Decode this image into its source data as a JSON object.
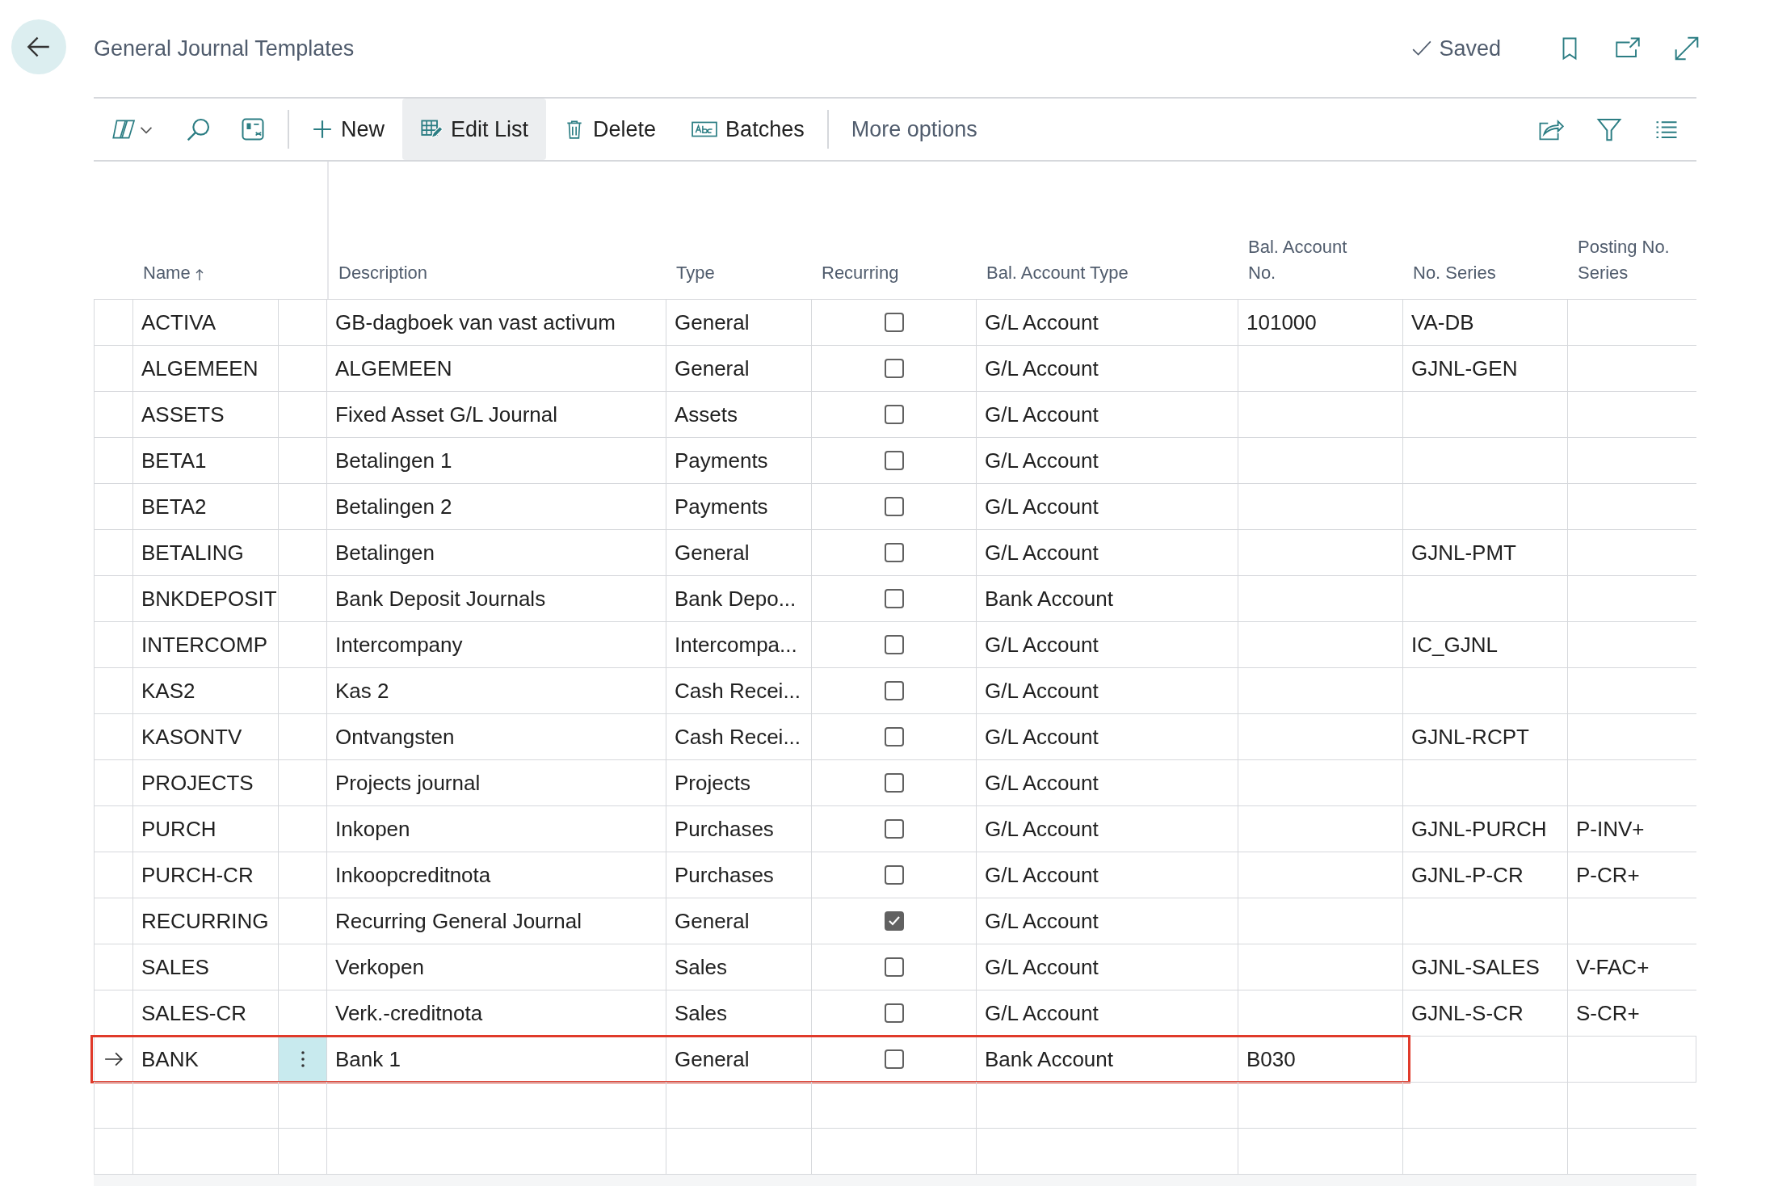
{
  "page": {
    "title": "General Journal Templates",
    "status": "Saved"
  },
  "toolbar": {
    "actions": [
      {
        "label": "New",
        "kind": "new",
        "selected": false
      },
      {
        "label": "Edit List",
        "kind": "edit",
        "selected": true
      },
      {
        "label": "Delete",
        "kind": "delete",
        "selected": false
      },
      {
        "label": "Batches",
        "kind": "batches",
        "selected": false
      }
    ],
    "more": "More options"
  },
  "table": {
    "columns": [
      {
        "label": "Name",
        "sorted": true
      },
      {
        "label": "Description",
        "sorted": false
      },
      {
        "label": "Type",
        "sorted": false
      },
      {
        "label": "Recurring",
        "sorted": false
      },
      {
        "label": "Bal. Account Type",
        "sorted": false
      },
      {
        "label": "Bal. Account No.",
        "sorted": false
      },
      {
        "label": "No. Series",
        "sorted": false
      },
      {
        "label": "Posting No. Series",
        "sorted": false
      }
    ],
    "rows": [
      {
        "name": "ACTIVA",
        "description": "GB-dagboek van vast activum",
        "type": "General",
        "recurring": false,
        "bal_account_type": "G/L Account",
        "bal_account_no": "101000",
        "no_series": "VA-DB",
        "posting_no_series": "",
        "selected": false
      },
      {
        "name": "ALGEMEEN",
        "description": "ALGEMEEN",
        "type": "General",
        "recurring": false,
        "bal_account_type": "G/L Account",
        "bal_account_no": "",
        "no_series": "GJNL-GEN",
        "posting_no_series": "",
        "selected": false
      },
      {
        "name": "ASSETS",
        "description": "Fixed Asset G/L Journal",
        "type": "Assets",
        "recurring": false,
        "bal_account_type": "G/L Account",
        "bal_account_no": "",
        "no_series": "",
        "posting_no_series": "",
        "selected": false
      },
      {
        "name": "BETA1",
        "description": "Betalingen 1",
        "type": "Payments",
        "recurring": false,
        "bal_account_type": "G/L Account",
        "bal_account_no": "",
        "no_series": "",
        "posting_no_series": "",
        "selected": false
      },
      {
        "name": "BETA2",
        "description": "Betalingen 2",
        "type": "Payments",
        "recurring": false,
        "bal_account_type": "G/L Account",
        "bal_account_no": "",
        "no_series": "",
        "posting_no_series": "",
        "selected": false
      },
      {
        "name": "BETALING",
        "description": "Betalingen",
        "type": "General",
        "recurring": false,
        "bal_account_type": "G/L Account",
        "bal_account_no": "",
        "no_series": "GJNL-PMT",
        "posting_no_series": "",
        "selected": false
      },
      {
        "name": "BNKDEPOSIT",
        "description": "Bank Deposit Journals",
        "type": "Bank Depo...",
        "recurring": false,
        "bal_account_type": "Bank Account",
        "bal_account_no": "",
        "no_series": "",
        "posting_no_series": "",
        "selected": false
      },
      {
        "name": "INTERCOMP",
        "description": "Intercompany",
        "type": "Intercompa...",
        "recurring": false,
        "bal_account_type": "G/L Account",
        "bal_account_no": "",
        "no_series": "IC_GJNL",
        "posting_no_series": "",
        "selected": false
      },
      {
        "name": "KAS2",
        "description": "Kas 2",
        "type": "Cash Recei...",
        "recurring": false,
        "bal_account_type": "G/L Account",
        "bal_account_no": "",
        "no_series": "",
        "posting_no_series": "",
        "selected": false
      },
      {
        "name": "KASONTV",
        "description": "Ontvangsten",
        "type": "Cash Recei...",
        "recurring": false,
        "bal_account_type": "G/L Account",
        "bal_account_no": "",
        "no_series": "GJNL-RCPT",
        "posting_no_series": "",
        "selected": false
      },
      {
        "name": "PROJECTS",
        "description": "Projects journal",
        "type": "Projects",
        "recurring": false,
        "bal_account_type": "G/L Account",
        "bal_account_no": "",
        "no_series": "",
        "posting_no_series": "",
        "selected": false
      },
      {
        "name": "PURCH",
        "description": "Inkopen",
        "type": "Purchases",
        "recurring": false,
        "bal_account_type": "G/L Account",
        "bal_account_no": "",
        "no_series": "GJNL-PURCH",
        "posting_no_series": "P-INV+",
        "selected": false
      },
      {
        "name": "PURCH-CR",
        "description": "Inkoopcreditnota",
        "type": "Purchases",
        "recurring": false,
        "bal_account_type": "G/L Account",
        "bal_account_no": "",
        "no_series": "GJNL-P-CR",
        "posting_no_series": "P-CR+",
        "selected": false
      },
      {
        "name": "RECURRING",
        "description": "Recurring General Journal",
        "type": "General",
        "recurring": true,
        "bal_account_type": "G/L Account",
        "bal_account_no": "",
        "no_series": "",
        "posting_no_series": "",
        "selected": false
      },
      {
        "name": "SALES",
        "description": "Verkopen",
        "type": "Sales",
        "recurring": false,
        "bal_account_type": "G/L Account",
        "bal_account_no": "",
        "no_series": "GJNL-SALES",
        "posting_no_series": "V-FAC+",
        "selected": false
      },
      {
        "name": "SALES-CR",
        "description": "Verk.-creditnota",
        "type": "Sales",
        "recurring": false,
        "bal_account_type": "G/L Account",
        "bal_account_no": "",
        "no_series": "GJNL-S-CR",
        "posting_no_series": "S-CR+",
        "selected": false
      },
      {
        "name": "BANK",
        "description": "Bank 1",
        "type": "General",
        "recurring": false,
        "bal_account_type": "Bank Account",
        "bal_account_no": "B030",
        "no_series": "",
        "posting_no_series": "",
        "selected": true
      }
    ]
  }
}
